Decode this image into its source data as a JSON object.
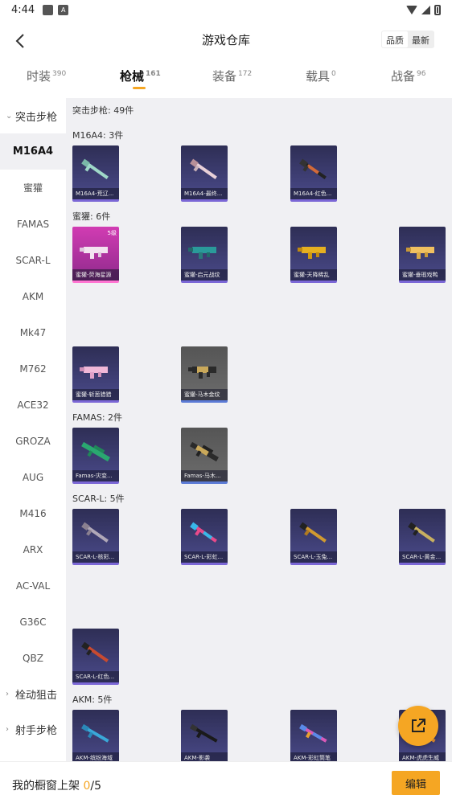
{
  "status_bar": {
    "time": "4:44",
    "icons": [
      "notification-icon",
      "a-icon",
      "wifi-icon",
      "cell-signal-icon",
      "battery-icon"
    ]
  },
  "header": {
    "title": "游戏仓库",
    "sort_options": [
      "品质",
      "最新"
    ],
    "active_sort": "品质"
  },
  "tabs": [
    {
      "label": "时装",
      "count": "390"
    },
    {
      "label": "枪械",
      "count": "161"
    },
    {
      "label": "装备",
      "count": "172"
    },
    {
      "label": "载具",
      "count": "0"
    },
    {
      "label": "战备",
      "count": "96"
    }
  ],
  "sidebar": {
    "group_assault": "突击步枪",
    "items": [
      "M16A4",
      "蜜獾",
      "FAMAS",
      "SCAR-L",
      "AKM",
      "Mk47",
      "M762",
      "ACE32",
      "GROZA",
      "AUG",
      "M416",
      "ARX",
      "AC-VAL",
      "G36C",
      "QBZ"
    ],
    "group_sniper": "栓动狙击",
    "group_marksman": "射手步枪"
  },
  "content": {
    "category_title": "突击步枪: 49件",
    "sections": [
      {
        "title": "M16A4: 3件",
        "cards": [
          "M16A4-荒辽...",
          "M16A4-最终...",
          "M16A4-红色..."
        ]
      },
      {
        "title": "蜜獾: 6件",
        "cards": [
          "蜜獾-荧海星源",
          "蜜獾-启元战纹",
          "蜜獾-天降稀乱",
          "蜜獾-垂瑕戏鸭",
          "蜜獾-斩葱猎猎",
          "蜜獾-马木金纹"
        ],
        "level_badge": "5级"
      },
      {
        "title": "FAMAS: 2件",
        "cards": [
          "Famas-灾变...",
          "Famas-马木..."
        ]
      },
      {
        "title": "SCAR-L: 5件",
        "cards": [
          "SCAR-L-核彩...",
          "SCAR-L-彩虹...",
          "SCAR-L-玉兔...",
          "SCAR-L-黄金...",
          "SCAR-L-红色..."
        ]
      },
      {
        "title": "AKM: 5件",
        "cards": [
          "AKM-缤纷海域",
          "AKM-影袭",
          "AKM-彩虹筒笔",
          "AKM-虎虎生威"
        ]
      }
    ]
  },
  "footer": {
    "label": "我的橱窗上架 ",
    "shelved": "0",
    "total": "/5",
    "edit_label": "编辑"
  },
  "colors": {
    "accent": "#f5a623",
    "content_bg": "#f0f0f3",
    "card_purple": "#3a3a70",
    "card_pink": "#c23ab0"
  }
}
